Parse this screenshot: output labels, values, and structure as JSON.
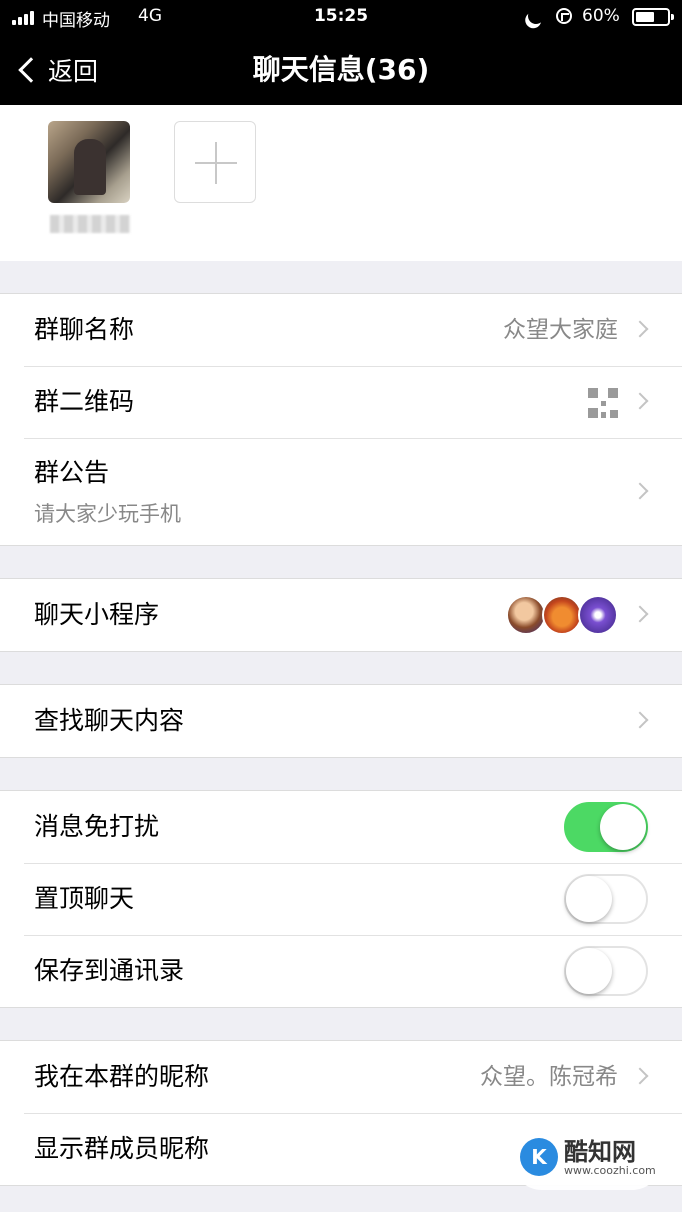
{
  "status": {
    "carrier": "中国移动",
    "network": "4G",
    "time": "15:25",
    "battery": "60%",
    "battery_level": 0.6
  },
  "nav": {
    "back_label": "返回",
    "title": "聊天信息(36)"
  },
  "group1": {
    "name_label": "群聊名称",
    "name_value": "众望大家庭",
    "qr_label": "群二维码",
    "notice_label": "群公告",
    "notice_value": "请大家少玩手机"
  },
  "mini_program": {
    "label": "聊天小程序"
  },
  "search": {
    "label": "查找聊天内容"
  },
  "settings": {
    "mute": {
      "label": "消息免打扰",
      "on": true
    },
    "pin": {
      "label": "置顶聊天",
      "on": false
    },
    "save": {
      "label": "保存到通讯录",
      "on": false
    }
  },
  "nickname": {
    "label": "我在本群的昵称",
    "value": "众望。陈冠希",
    "show_label": "显示群成员昵称"
  },
  "watermark": {
    "name": "酷知网",
    "url": "www.coozhi.com"
  },
  "colors": {
    "toggle_on": "#4cd964",
    "nav_bg": "#000000",
    "bg": "#efeff4"
  }
}
